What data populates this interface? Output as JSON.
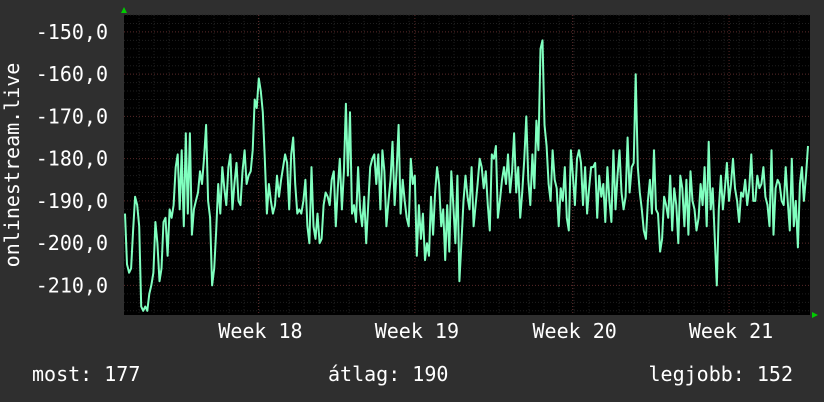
{
  "chart_data": {
    "type": "line",
    "ylabel": "onlinestream.live",
    "yticks": [
      "-150,0",
      "-160,0",
      "-170,0",
      "-180,0",
      "-190,0",
      "-200,0",
      "-210,0"
    ],
    "ytick_values": [
      -150,
      -160,
      -170,
      -180,
      -190,
      -200,
      -210
    ],
    "ylim": [
      -217,
      -146
    ],
    "xticks": [
      "Week 18",
      "Week 19",
      "Week 20",
      "Week 21"
    ],
    "xtick_positions": [
      0.196,
      0.424,
      0.654,
      0.882
    ],
    "grid": true,
    "series": [
      {
        "color": "#80ffbf",
        "values": [
          -193,
          -205,
          -207,
          -206,
          -197,
          -189,
          -191,
          -196,
          -215,
          -216,
          -215,
          -216,
          -212,
          -210,
          -207,
          -195,
          -200,
          -209,
          -206,
          -195,
          -194,
          -203,
          -192,
          -194,
          -191,
          -182,
          -179,
          -192,
          -178,
          -196,
          -174,
          -193,
          -174,
          -198,
          -192,
          -190,
          -188,
          -183,
          -186,
          -180,
          -172,
          -190,
          -194,
          -210,
          -206,
          -197,
          -186,
          -193,
          -182,
          -187,
          -191,
          -182,
          -179,
          -192,
          -186,
          -181,
          -190,
          -191,
          -183,
          -178,
          -186,
          -184,
          -183,
          -178,
          -166,
          -168,
          -161,
          -164,
          -169,
          -180,
          -193,
          -186,
          -190,
          -193,
          -191,
          -184,
          -189,
          -185,
          -182,
          -179,
          -181,
          -192,
          -179,
          -175,
          -186,
          -193,
          -192,
          -193,
          -190,
          -185,
          -196,
          -200,
          -182,
          -196,
          -199,
          -193,
          -200,
          -199,
          -191,
          -188,
          -189,
          -191,
          -185,
          -183,
          -196,
          -187,
          -180,
          -192,
          -183,
          -167,
          -184,
          -169,
          -193,
          -191,
          -195,
          -182,
          -192,
          -196,
          -189,
          -200,
          -191,
          -182,
          -180,
          -179,
          -186,
          -179,
          -192,
          -178,
          -183,
          -196,
          -190,
          -185,
          -176,
          -191,
          -183,
          -172,
          -193,
          -185,
          -190,
          -194,
          -196,
          -180,
          -186,
          -184,
          -203,
          -191,
          -199,
          -193,
          -204,
          -200,
          -203,
          -189,
          -198,
          -188,
          -182,
          -186,
          -196,
          -192,
          -204,
          -191,
          -202,
          -183,
          -191,
          -200,
          -184,
          -209,
          -200,
          -190,
          -184,
          -189,
          -192,
          -182,
          -196,
          -191,
          -186,
          -180,
          -182,
          -187,
          -183,
          -191,
          -197,
          -179,
          -180,
          -177,
          -194,
          -190,
          -185,
          -182,
          -186,
          -179,
          -188,
          -183,
          -174,
          -188,
          -182,
          -194,
          -188,
          -180,
          -170,
          -185,
          -191,
          -179,
          -187,
          -171,
          -178,
          -154,
          -152,
          -172,
          -177,
          -186,
          -190,
          -178,
          -185,
          -187,
          -196,
          -187,
          -190,
          -182,
          -194,
          -197,
          -178,
          -184,
          -191,
          -180,
          -178,
          -181,
          -191,
          -182,
          -193,
          -187,
          -182,
          -182,
          -181,
          -194,
          -184,
          -189,
          -186,
          -195,
          -182,
          -190,
          -195,
          -178,
          -192,
          -184,
          -178,
          -188,
          -192,
          -189,
          -175,
          -188,
          -182,
          -181,
          -160,
          -182,
          -188,
          -192,
          -197,
          -199,
          -190,
          -185,
          -193,
          -178,
          -192,
          -193,
          -202,
          -199,
          -189,
          -191,
          -194,
          -184,
          -197,
          -187,
          -191,
          -200,
          -184,
          -187,
          -196,
          -185,
          -198,
          -183,
          -190,
          -192,
          -197,
          -194,
          -186,
          -191,
          -182,
          -196,
          -176,
          -192,
          -187,
          -199,
          -210,
          -192,
          -184,
          -192,
          -187,
          -181,
          -190,
          -186,
          -180,
          -187,
          -190,
          -195,
          -188,
          -189,
          -185,
          -191,
          -187,
          -179,
          -190,
          -190,
          -184,
          -187,
          -186,
          -182,
          -189,
          -191,
          -196,
          -178,
          -198,
          -187,
          -185,
          -186,
          -190,
          -191,
          -182,
          -190,
          -197,
          -180,
          -196,
          -190,
          -201,
          -186,
          -182,
          -190,
          -184,
          -177
        ]
      }
    ]
  },
  "footer": {
    "now": "most: 177",
    "avg": "átlag: 190",
    "best": "legjobb: 152"
  },
  "colors": {
    "background": "#2f2f2f",
    "plot_background": "#000000",
    "line": "#80ffbf",
    "grid": "#3a3a3a",
    "axis_arrow": "#00cc00"
  }
}
